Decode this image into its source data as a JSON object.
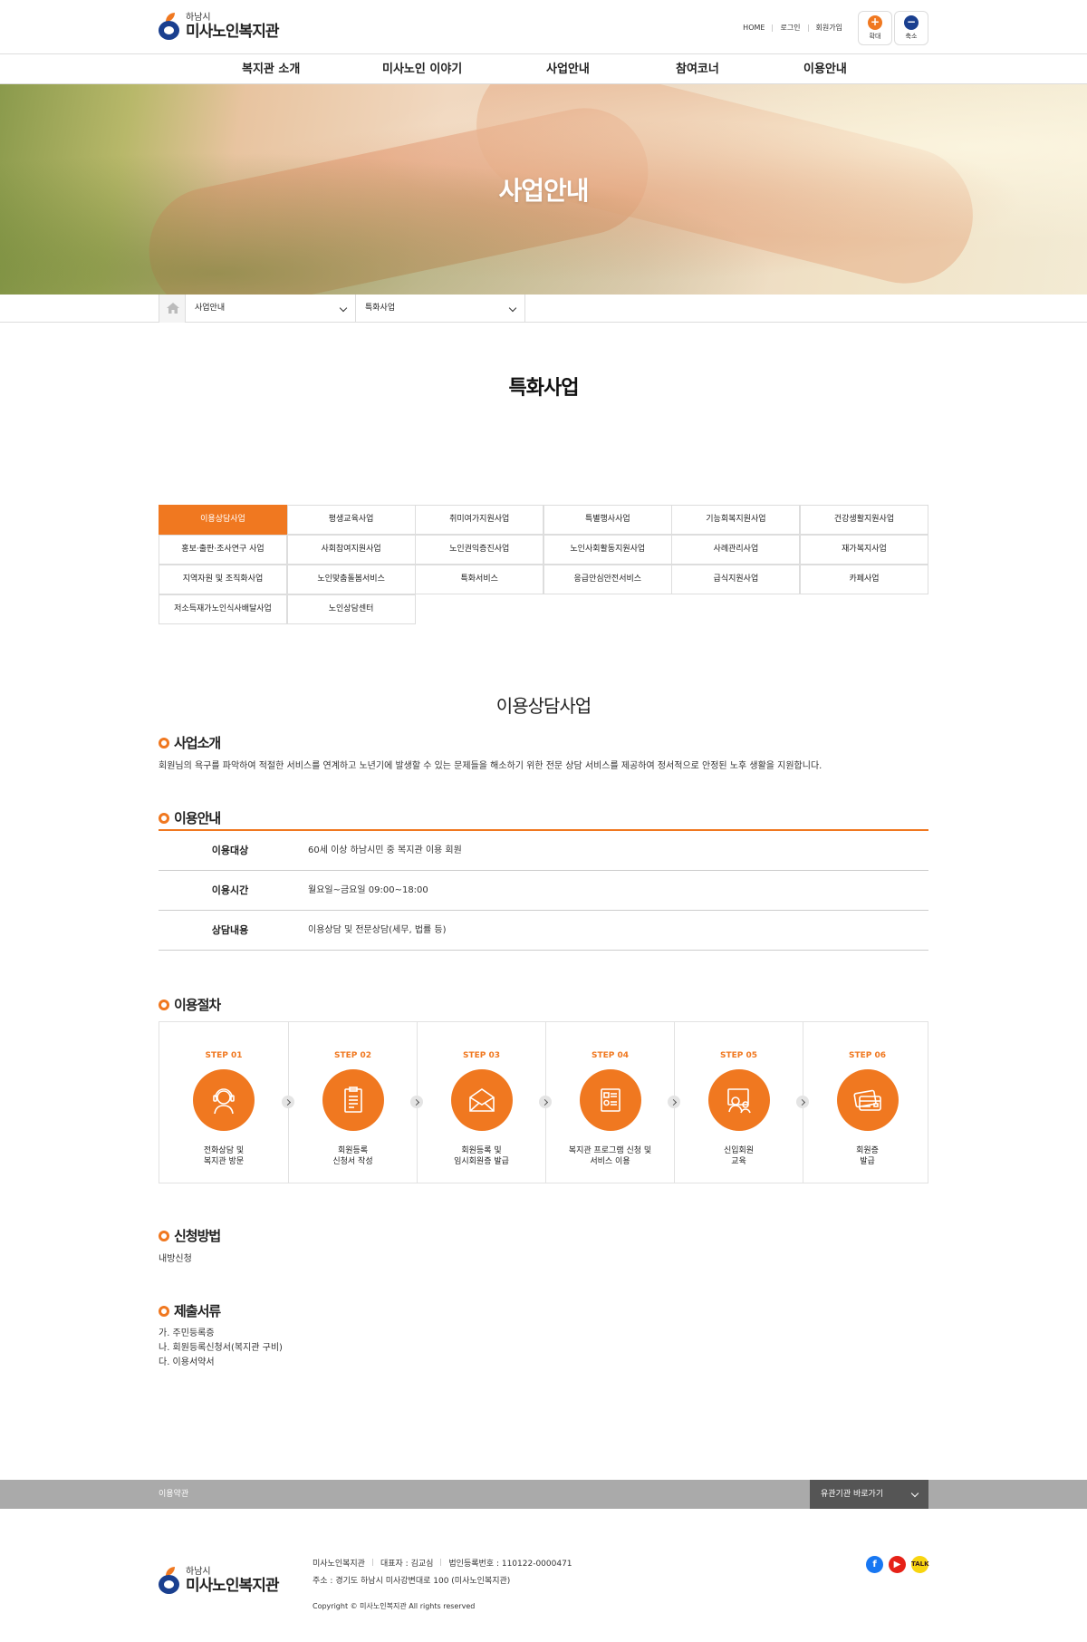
{
  "header": {
    "logo_small": "하남시",
    "logo_big": "미사노인복지관",
    "util_links": [
      "HOME",
      "로그인",
      "회원가입"
    ],
    "zoom_in_label": "확대",
    "zoom_out_label": "축소"
  },
  "gnb": [
    "복지관 소개",
    "미사노인 이야기",
    "사업안내",
    "참여코너",
    "이용안내"
  ],
  "hero_title": "사업안내",
  "breadcrumb": {
    "level1": "사업안내",
    "level2": "특화사업"
  },
  "page_title": "특화사업",
  "tabs": [
    "이용상담사업",
    "평생교육사업",
    "취미여가지원사업",
    "특별행사사업",
    "기능회복지원사업",
    "건강생활지원사업",
    "홍보·출판·조사연구 사업",
    "사회참여지원사업",
    "노인권익증진사업",
    "노인사회활동지원사업",
    "사례관리사업",
    "재가복지사업",
    "지역자원 및 조직화사업",
    "노인맞춤돌봄서비스",
    "특화서비스",
    "응급안심안전서비스",
    "급식지원사업",
    "카페사업",
    "저소득재가노인식사배달사업",
    "노인상담센터"
  ],
  "active_tab": "이용상담사업",
  "content": {
    "title": "이용상담사업",
    "intro_heading": "사업소개",
    "intro_text": "회원님의 욕구를 파악하여 적절한 서비스를 연계하고 노년기에 발생할 수 있는 문제들을 해소하기 위한 전문 상담 서비스를 제공하여 정서적으로 안정된 노후 생활을 지원합니다.",
    "usage_heading": "이용안내",
    "usage_rows": [
      {
        "key": "이용대상",
        "value": "60세 이상 하남시민 중 복지관 이용 회원"
      },
      {
        "key": "이용시간",
        "value": "월요일~금요일 09:00~18:00"
      },
      {
        "key": "상담내용",
        "value": "이용상담 및 전문상담(세무, 법률 등)"
      }
    ],
    "procedure_heading": "이용절차",
    "steps": [
      {
        "no": "STEP 01",
        "line1": "전화상담 및",
        "line2": "복지관 방문",
        "icon": "counselor-headset-icon"
      },
      {
        "no": "STEP 02",
        "line1": "회원등록",
        "line2": "신청서 작성",
        "icon": "clipboard-form-icon"
      },
      {
        "no": "STEP 03",
        "line1": "회원등록 및",
        "line2": "임시회원증 발급",
        "icon": "envelope-icon"
      },
      {
        "no": "STEP 04",
        "line1": "복지관 프로그램 신청 및",
        "line2": "서비스 이용",
        "icon": "application-form-icon"
      },
      {
        "no": "STEP 05",
        "line1": "신입회원",
        "line2": "교육",
        "icon": "member-education-icon"
      },
      {
        "no": "STEP 06",
        "line1": "회원증",
        "line2": "발급",
        "icon": "member-card-icon"
      }
    ],
    "method_heading": "신청방법",
    "method_text": "내방신청",
    "docs_heading": "제출서류",
    "docs": [
      "가. 주민등록증",
      "나. 회원등록신청서(복지관 구비)",
      "다. 이용서약서"
    ]
  },
  "footer": {
    "terms": "이용약관",
    "related_sites": "유관기관 바로가기",
    "org_name": "미사노인복지관",
    "ceo": "대표자 : 김교심",
    "reg_no": "법인등록번호 : 110122-0000471",
    "address": "주소 : 경기도 하남시 미사강변대로 100 (미사노인복지관)",
    "copyright": "Copyright © 미사노인복지관 All rights reserved",
    "sns": [
      "facebook-icon",
      "youtube-icon",
      "kakaotalk-icon"
    ],
    "kakao_label": "TALK"
  },
  "colors": {
    "accent": "#f07820",
    "brand_navy": "#1a3f8f",
    "footer_bar": "#aaaaaa"
  }
}
